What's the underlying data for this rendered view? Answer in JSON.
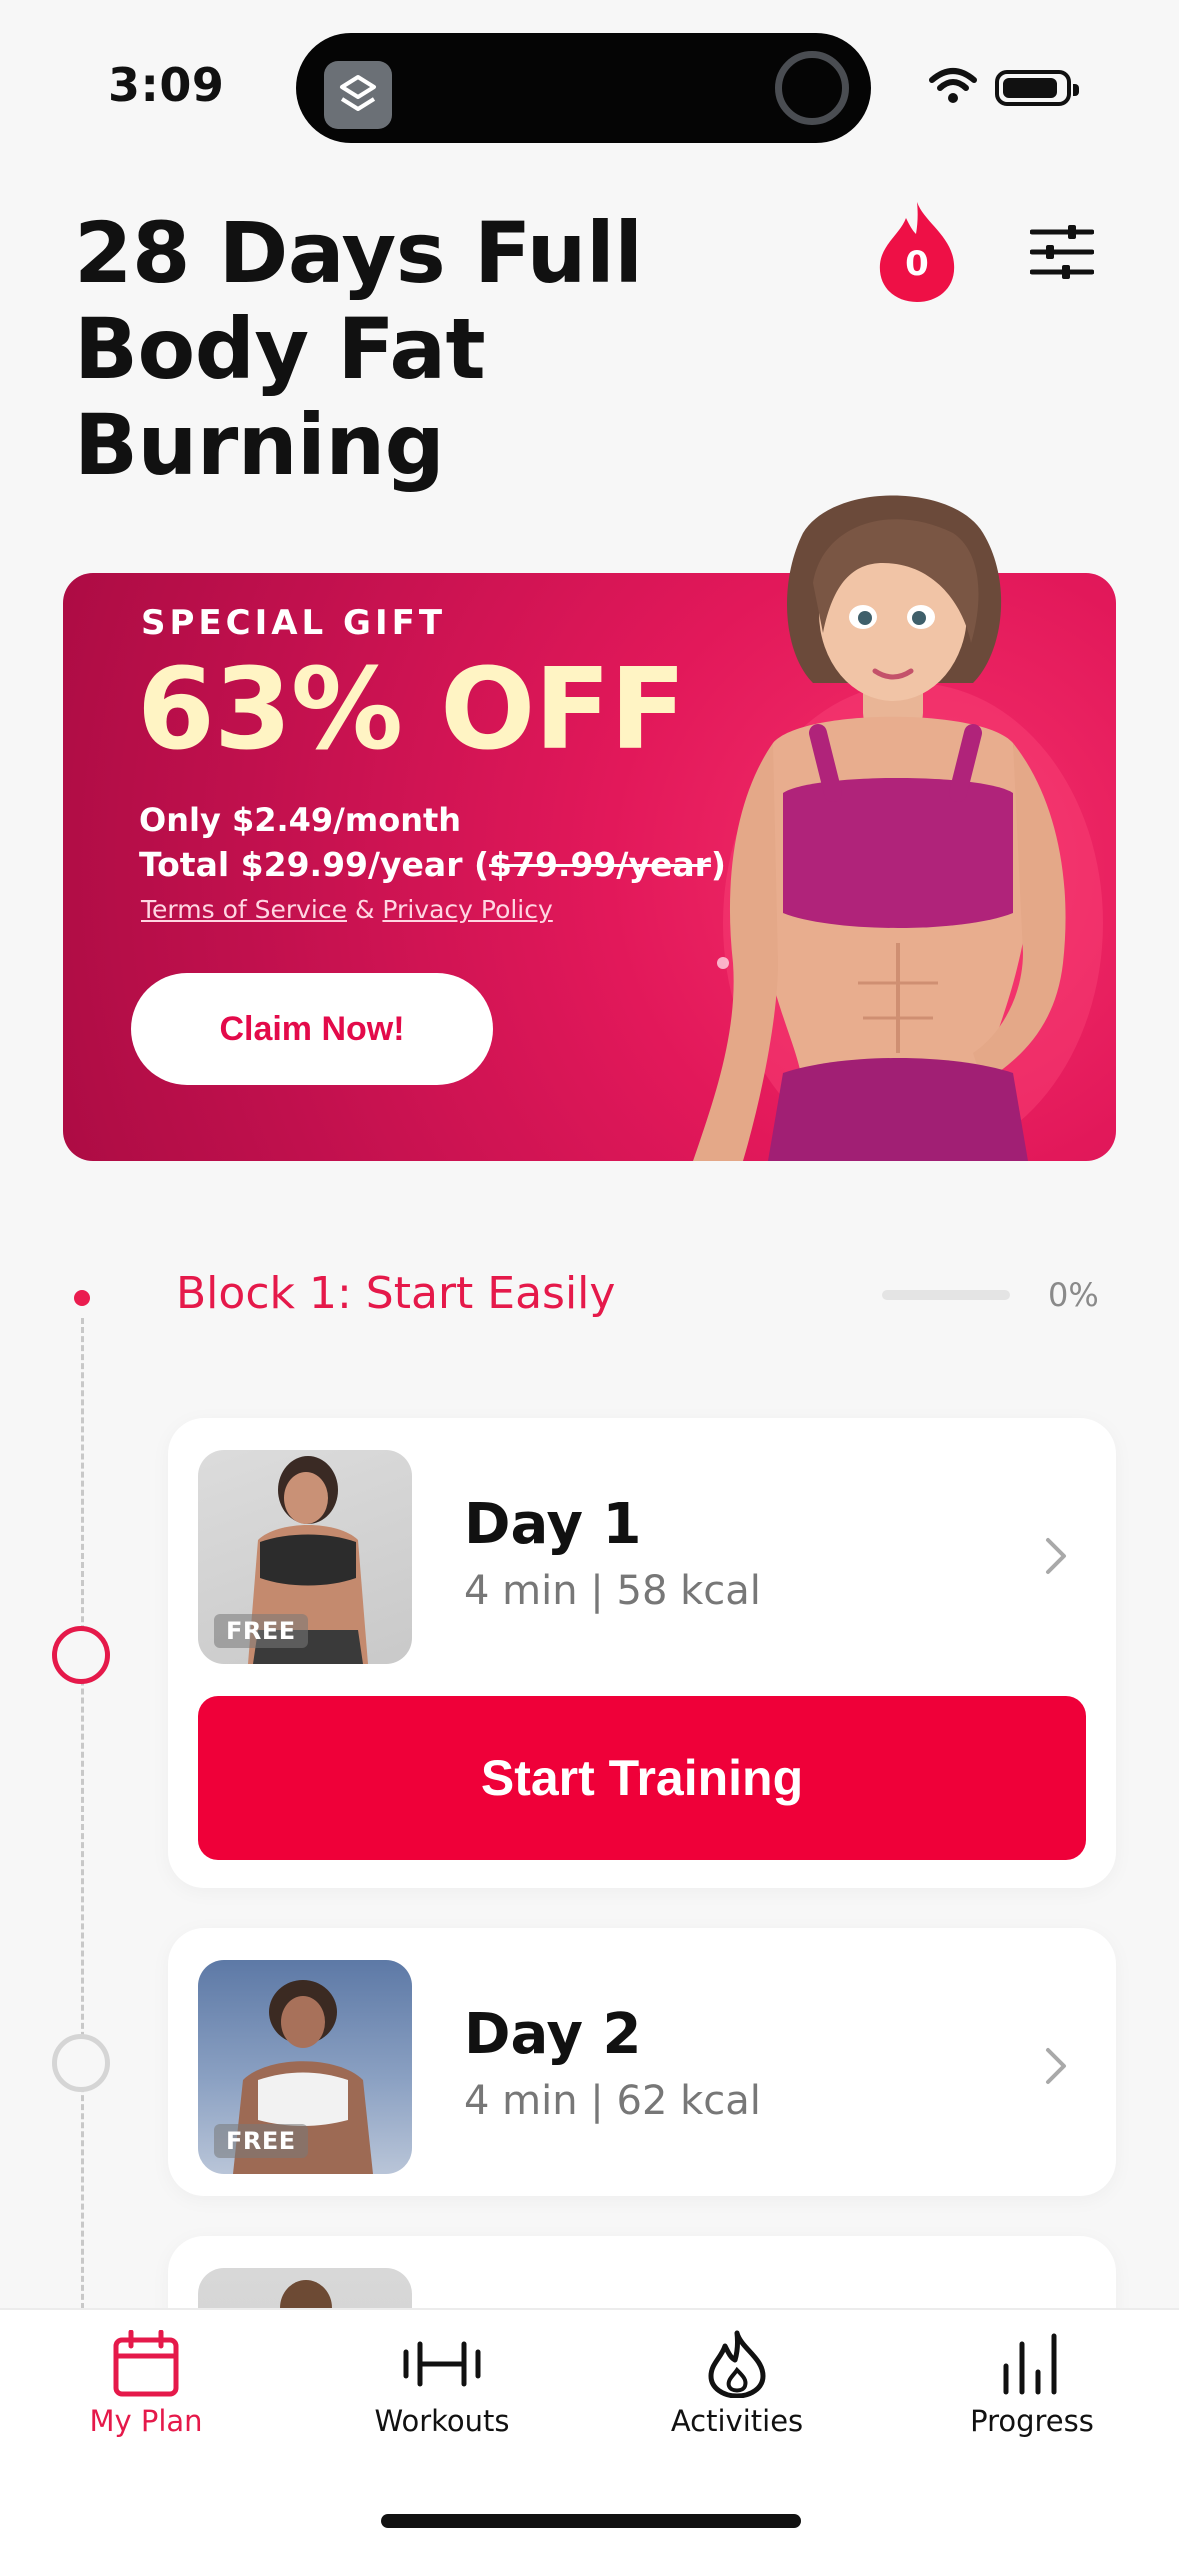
{
  "status_bar": {
    "time": "3:09"
  },
  "header": {
    "title": "28 Days Full Body Fat Burning",
    "streak_count": "0"
  },
  "promo": {
    "eyebrow": "SPECIAL GIFT",
    "headline": "63% OFF",
    "monthly_price": "Only $2.49/month",
    "yearly_prefix": "Total $29.99/year (",
    "yearly_strike": "$79.99/year",
    "yearly_suffix": ")",
    "terms_label": "Terms of Service",
    "amp": "&",
    "privacy_label": "Privacy Policy",
    "cta_label": "Claim Now!"
  },
  "block": {
    "title": "Block 1: Start Easily",
    "progress_label": "0%",
    "progress": 0
  },
  "days": [
    {
      "title": "Day 1",
      "meta": "4 min | 58 kcal",
      "tag": "FREE",
      "cta": "Start Training"
    },
    {
      "title": "Day 2",
      "meta": "4 min | 62 kcal",
      "tag": "FREE"
    }
  ],
  "nav": {
    "items": [
      {
        "label": "My Plan",
        "icon": "calendar-icon",
        "active": true
      },
      {
        "label": "Workouts",
        "icon": "dumbbell-icon",
        "active": false
      },
      {
        "label": "Activities",
        "icon": "flame-icon",
        "active": false
      },
      {
        "label": "Progress",
        "icon": "bar-chart-icon",
        "active": false
      }
    ]
  },
  "colors": {
    "accent": "#ef0039",
    "brand_red": "#e5194a",
    "banner": "#d0104f",
    "headline_cream": "#fff4c4"
  }
}
